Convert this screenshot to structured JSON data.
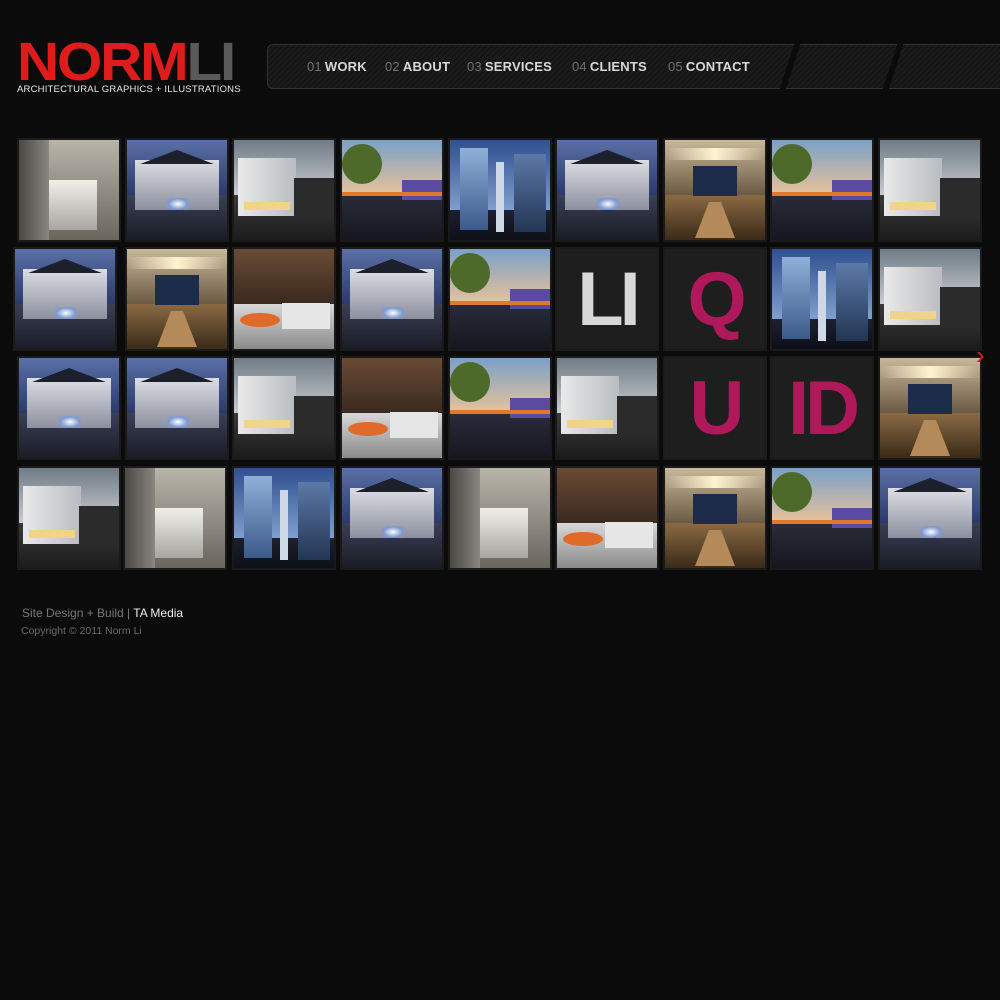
{
  "logo": {
    "part1": "NORM",
    "part2": "LI",
    "tagline": "ARCHITECTURAL GRAPHICS + ILLUSTRATIONS"
  },
  "nav": [
    {
      "num": "01",
      "label": "WORK"
    },
    {
      "num": "02",
      "label": "ABOUT"
    },
    {
      "num": "03",
      "label": "SERVICES"
    },
    {
      "num": "04",
      "label": "CLIENTS"
    },
    {
      "num": "05",
      "label": "CONTACT"
    }
  ],
  "gallery": {
    "rows": [
      [
        "lobby",
        "mansion",
        "modern",
        "street",
        "towers",
        "mansion",
        "dining",
        "street",
        "modern"
      ],
      [
        "mansion",
        "dining",
        "lounge",
        "mansion",
        "street",
        "letter:LI",
        "letter:Q",
        "towers",
        "modern"
      ],
      [
        "mansion",
        "mansion",
        "modern",
        "lounge",
        "street",
        "modern",
        "letter:U",
        "letter:ID",
        "dining"
      ],
      [
        "modern",
        "lobby",
        "towers",
        "mansion",
        "lobby",
        "lounge",
        "dining",
        "street",
        "mansion"
      ]
    ],
    "letter_colors": {
      "LI": "#d8d8d8",
      "Q": "#b0185c",
      "U": "#b0185c",
      "ID": "#b0185c"
    }
  },
  "footer": {
    "credit_prefix": "Site Design + Build | ",
    "credit_link": "TA Media",
    "copyright": "Copyright © 2011 Norm Li"
  }
}
